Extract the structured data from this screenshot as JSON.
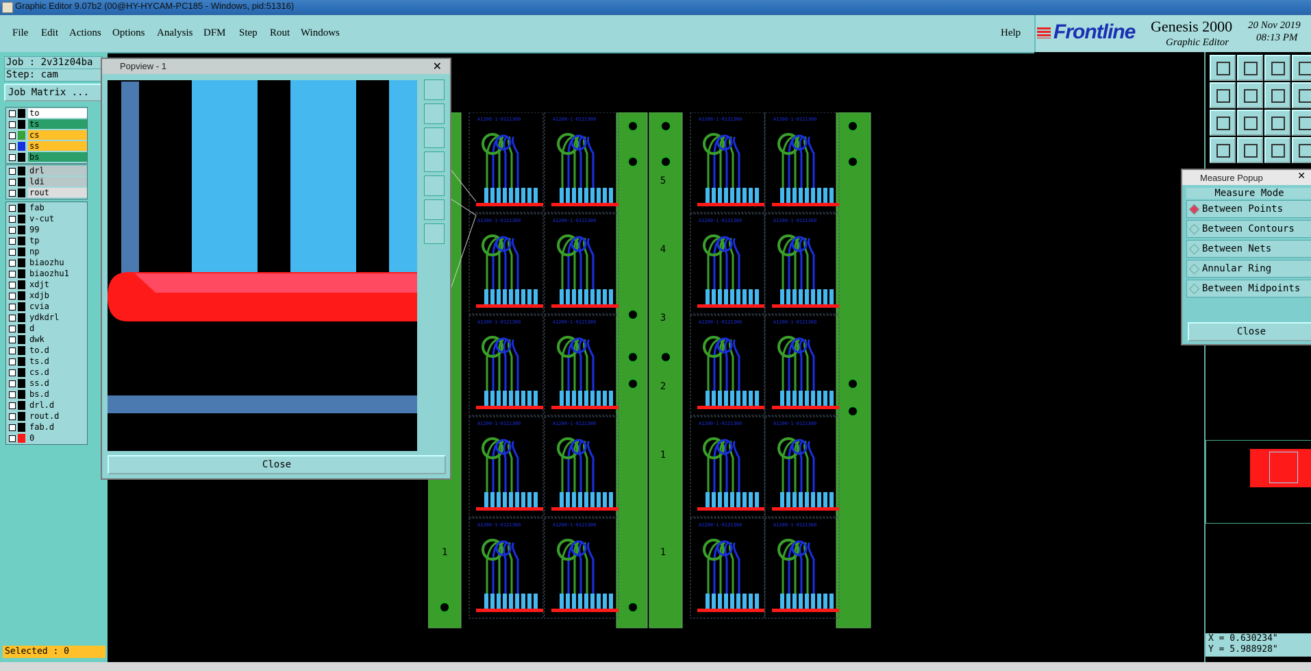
{
  "window": {
    "title": "Graphic Editor 9.07b2 (00@HY-HYCAM-PC185 - Windows, pid:51316)"
  },
  "menu": {
    "items": [
      "File",
      "Edit",
      "Actions",
      "Options",
      "Analysis",
      "DFM",
      "Step",
      "Rout",
      "Windows"
    ],
    "help": "Help"
  },
  "brand": {
    "logo": "Frontline",
    "product": "Genesis 2000",
    "subtitle": "Graphic Editor",
    "date": "20 Nov 2019",
    "time": "08:13 PM"
  },
  "job": {
    "job_line": "Job : 2v31z04ba",
    "step_line": "Step: cam",
    "matrix_button": "Job Matrix ..."
  },
  "layers": {
    "board": [
      {
        "name": "to",
        "color": "#ffffff",
        "swatch": "#000000"
      },
      {
        "name": "ts",
        "color": "#2a9f6a",
        "swatch": "#000000"
      },
      {
        "name": "cs",
        "color": "#ffc02a",
        "swatch": "#3aa23a"
      },
      {
        "name": "ss",
        "color": "#ffc02a",
        "swatch": "#1a2fe0"
      },
      {
        "name": "bs",
        "color": "#2a9f6a",
        "swatch": "#000000"
      }
    ],
    "drill": [
      {
        "name": "drl",
        "color": "#b8c8c8"
      },
      {
        "name": "ldi",
        "color": "#b8c8c8"
      },
      {
        "name": "rout",
        "color": "#dddddd"
      }
    ],
    "misc": [
      "fab",
      "v-cut",
      "99",
      "tp",
      "np",
      "biaozhu",
      "biaozhu1",
      "xdjt",
      "xdjb",
      "cvia",
      "ydkdrl",
      "d",
      "dwk",
      "to.d",
      "ts.d",
      "cs.d",
      "ss.d",
      "bs.d",
      "drl.d",
      "rout.d",
      "fab.d",
      "0"
    ]
  },
  "status": {
    "selected": "Selected : 0"
  },
  "popview": {
    "title": "Popview - 1",
    "close_label": "Close"
  },
  "measure": {
    "title": "Measure Popup",
    "header": "Measure Mode",
    "options": [
      "Between Points",
      "Between Contours",
      "Between Nets",
      "Annular Ring",
      "Between Midpoints"
    ],
    "selected_option": "Between Points",
    "close_label": "Close"
  },
  "coords": {
    "x": "X = 0.630234\"",
    "y": "Y = 5.988928\""
  },
  "pcb": {
    "part_label": "A1200-1-0121300",
    "panel_numbers": [
      "5",
      "4",
      "3",
      "2",
      "1"
    ],
    "side_numbers": [
      "1",
      "1"
    ]
  },
  "colors": {
    "copper": "#3a9f2a",
    "pad": "#46b8f0",
    "trace_blue": "#1a2fe0",
    "edge": "#ff1a1a",
    "panel": "#9ed8d8"
  }
}
